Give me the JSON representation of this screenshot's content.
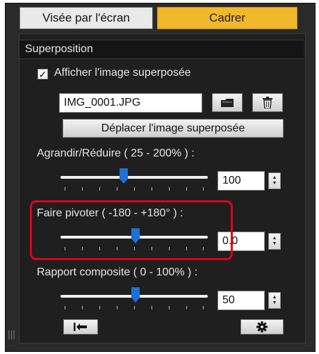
{
  "tabs": [
    {
      "label": "Visée par l'écran",
      "active": false
    },
    {
      "label": "Cadrer",
      "active": true
    }
  ],
  "section": {
    "title": "Superposition"
  },
  "overlay": {
    "show_label": "Afficher l'image superposée",
    "show_checked": true,
    "filename": "IMG_0001.JPG",
    "move_button_label": "Déplacer l'image superposée"
  },
  "resize": {
    "label": "Agrandir/Réduire ( 25 - 200% ) :",
    "value": "100",
    "min": 25,
    "max": 200,
    "position_fraction": 0.43
  },
  "rotate": {
    "label": "Faire pivoter ( -180 - +180° ) :",
    "value": "0.0",
    "min": -180,
    "max": 180,
    "position_fraction": 0.5
  },
  "composite": {
    "label": "Rapport composite ( 0 - 100% ) :",
    "value": "50",
    "min": 0,
    "max": 100,
    "position_fraction": 0.5
  },
  "icons": [
    "checkbox-check-icon",
    "folder-icon",
    "trash-icon",
    "spinner-up-icon",
    "spinner-down-icon",
    "reset-arrow-icon",
    "gear-icon"
  ],
  "colors": {
    "accent": "#f1b82c",
    "slider_thumb": "#1e6fd9",
    "highlight": "#e2001a",
    "panel": "#1f1f1f"
  }
}
